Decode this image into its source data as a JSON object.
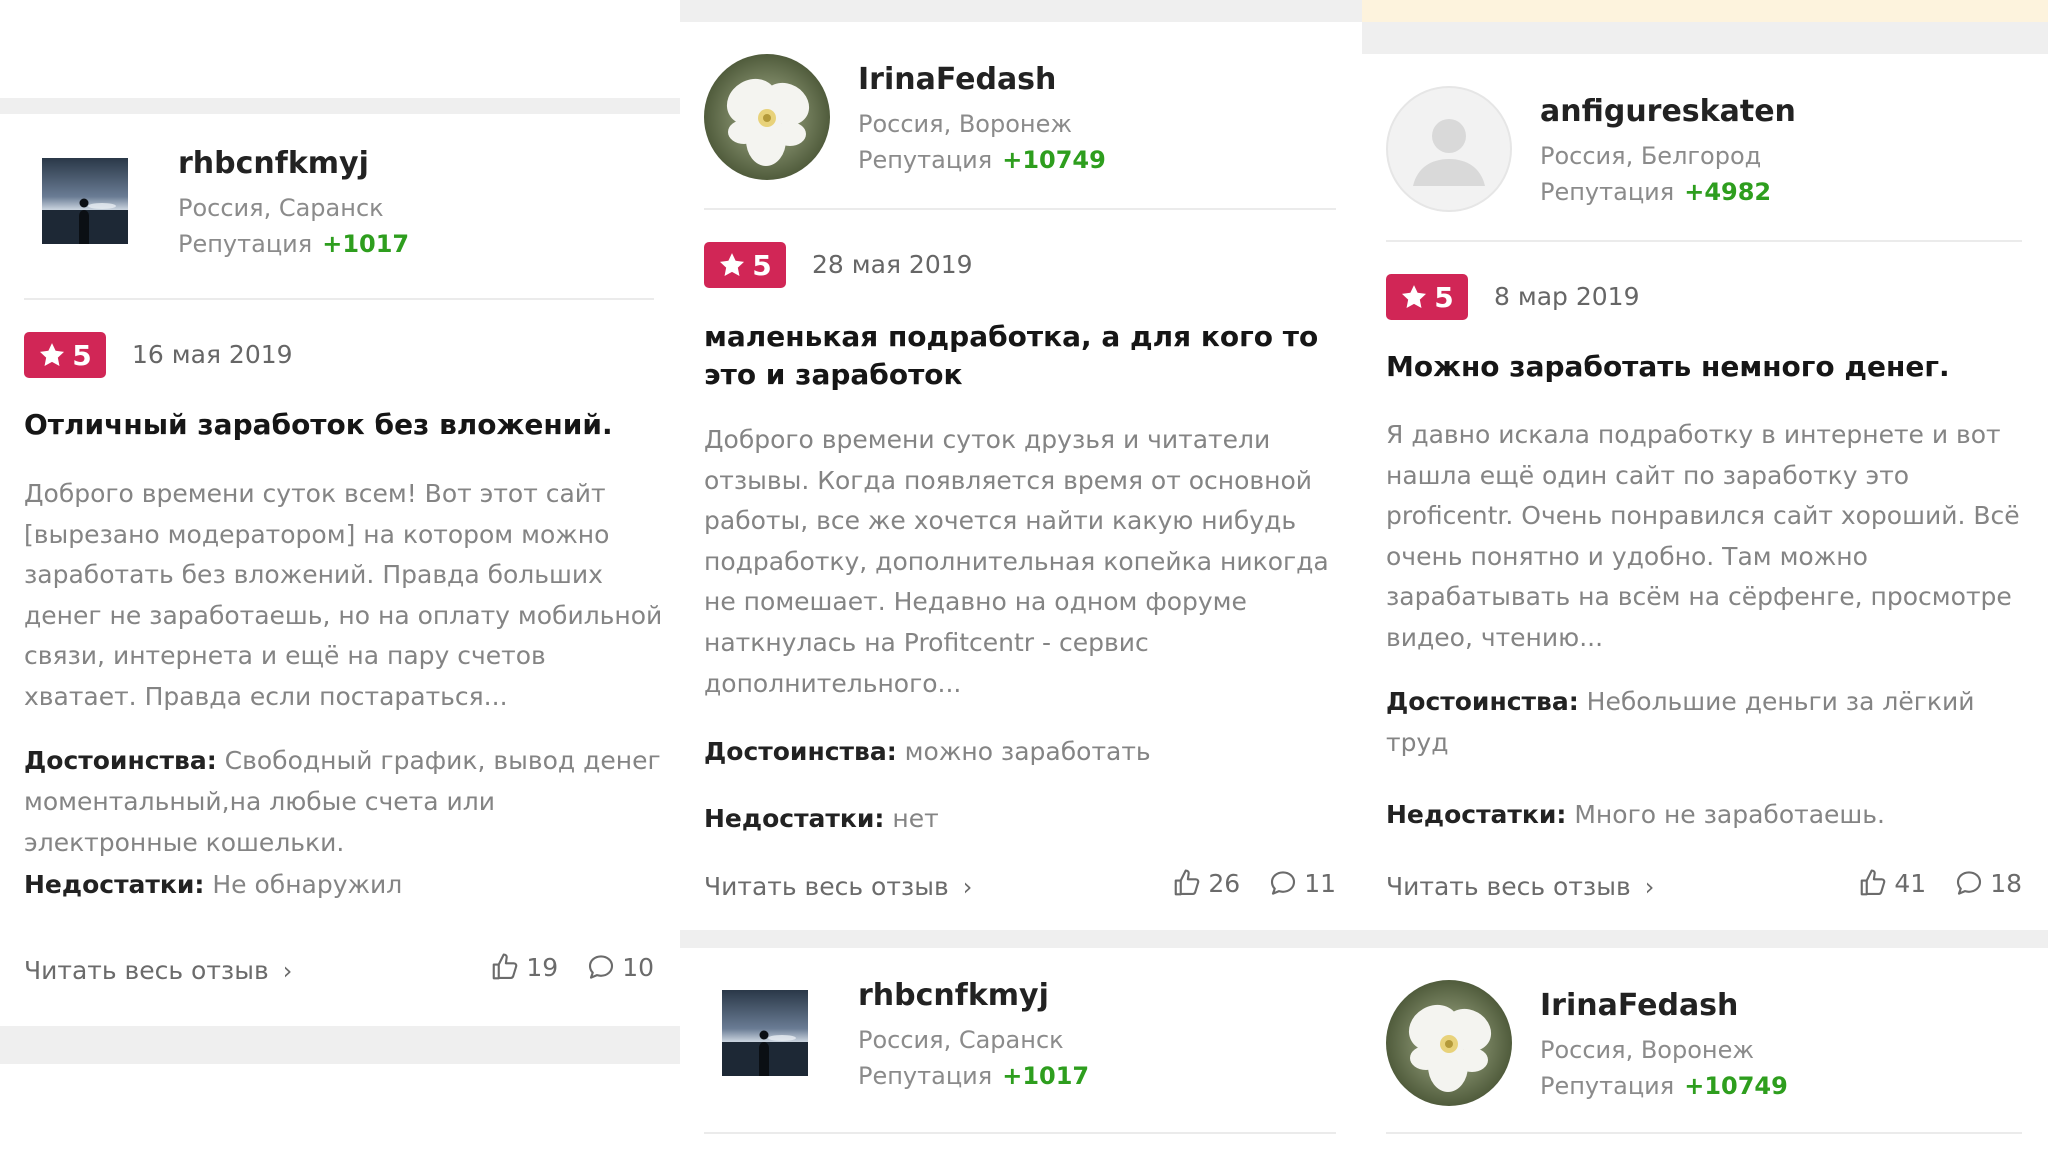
{
  "colors": {
    "badge": "#d12656",
    "reputation": "#2e9e1e",
    "separator": "#efefef"
  },
  "cards": [
    {
      "author": {
        "name": "rhbcnfkmyj",
        "location": "Россия, Саранск",
        "reputation_label": "Репутация",
        "reputation": "+1017",
        "avatar": "landscape-photo"
      },
      "rating": "5",
      "date": "16 мая 2019",
      "title": "Отличный заработок без вложений.",
      "text": "Доброго времени суток всем! Вот этот сайт [вырезано модератором] на котором можно заработать без вложений. Правда больших денег не заработаешь, но на оплату мобильной связи, интернета и ещё на пару счетов хватает. Правда если постараться...",
      "pros_label": "Достоинства:",
      "pros": "Свободный график, вывод денег моментальный,на любые счета или электронные кошельки.",
      "cons_label": "Недостатки:",
      "cons": "Не обнаружил",
      "read_more": "Читать весь отзыв",
      "likes": "19",
      "comments": "10"
    },
    {
      "author": {
        "name": "IrinaFedash",
        "location": "Россия, Воронеж",
        "reputation_label": "Репутация",
        "reputation": "+10749",
        "avatar": "orchid-photo"
      },
      "rating": "5",
      "date": "28 мая 2019",
      "title": "маленькая подработка, а для кого то это и заработок",
      "text": "Доброго времени суток друзья и читатели отзывы. Когда появляется время от основной работы, все же хочется найти какую нибудь подработку, дополнительная копейка никогда не помешает. Недавно на одном форуме наткнулась на Profitcentr - сервис дополнительного...",
      "pros_label": "Достоинства:",
      "pros": "можно заработать",
      "cons_label": "Недостатки:",
      "cons": "нет",
      "read_more": "Читать весь отзыв",
      "likes": "26",
      "comments": "11"
    },
    {
      "author": {
        "name": "anfigureskaten",
        "location": "Россия, Белгород",
        "reputation_label": "Репутация",
        "reputation": "+4982",
        "avatar": "default-user"
      },
      "rating": "5",
      "date": "8 мар 2019",
      "title": "Можно заработать немного денег.",
      "text": "Я давно искала подработку в интернете и вот нашла ещё один сайт по заработку это proficentr. Очень понравился сайт хороший. Всё очень понятно и удобно. Там можно зарабатывать на всём на сёрфенге, просмотре видео, чтению...",
      "pros_label": "Достоинства:",
      "pros": "Небольшие деньги за лёгкий труд",
      "cons_label": "Недостатки:",
      "cons": "Много не заработаешь.",
      "read_more": "Читать весь отзыв",
      "likes": "41",
      "comments": "18"
    }
  ],
  "next_authors": [
    {
      "name": "rhbcnfkmyj",
      "location": "Россия, Саранск",
      "reputation_label": "Репутация",
      "reputation": "+1017",
      "avatar": "landscape-photo"
    },
    {
      "name": "IrinaFedash",
      "location": "Россия, Воронеж",
      "reputation_label": "Репутация",
      "reputation": "+10749",
      "avatar": "orchid-photo"
    }
  ]
}
